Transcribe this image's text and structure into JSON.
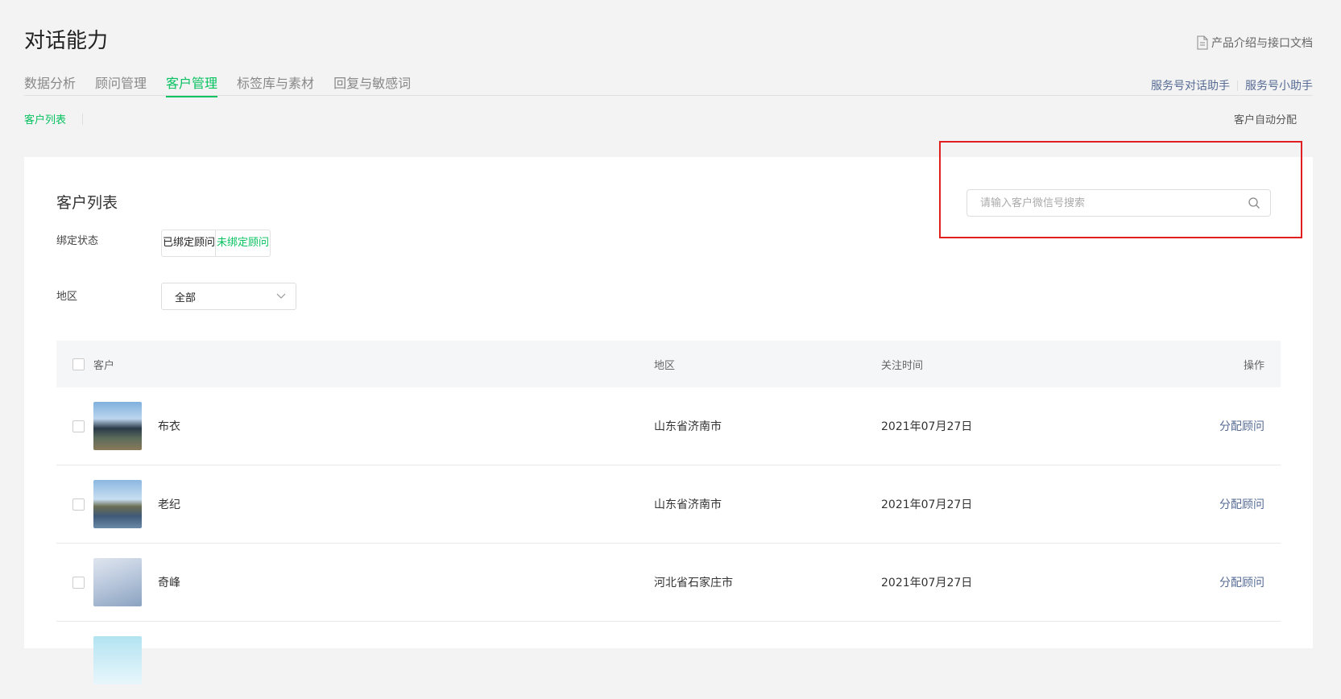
{
  "page": {
    "title": "对话能力",
    "doc_link": "产品介绍与接口文档"
  },
  "tabs": [
    {
      "label": "数据分析",
      "active": false
    },
    {
      "label": "顾问管理",
      "active": false
    },
    {
      "label": "客户管理",
      "active": true
    },
    {
      "label": "标签库与素材",
      "active": false
    },
    {
      "label": "回复与敏感词",
      "active": false
    }
  ],
  "right_links": [
    "服务号对话助手",
    "服务号小助手"
  ],
  "subnav": {
    "current": "客户列表",
    "auto_assign": "客户自动分配"
  },
  "card": {
    "title": "客户列表",
    "search_placeholder": "请输入客户微信号搜索"
  },
  "filters": {
    "bind_label": "绑定状态",
    "bind_options": [
      "已绑定顾问",
      "未绑定顾问"
    ],
    "bind_selected": "未绑定顾问",
    "region_label": "地区",
    "region_value": "全部"
  },
  "table": {
    "headers": {
      "customer": "客户",
      "region": "地区",
      "follow_time": "关注时间",
      "action": "操作"
    },
    "rows": [
      {
        "name": "布衣",
        "region": "山东省济南市",
        "time": "2021年07月27日",
        "action": "分配顾问"
      },
      {
        "name": "老纪",
        "region": "山东省济南市",
        "time": "2021年07月27日",
        "action": "分配顾问"
      },
      {
        "name": "奇峰",
        "region": "河北省石家庄市",
        "time": "2021年07月27日",
        "action": "分配顾问"
      }
    ]
  },
  "colors": {
    "accent": "#07c160",
    "link": "#576b95",
    "highlight": "#e02020"
  }
}
